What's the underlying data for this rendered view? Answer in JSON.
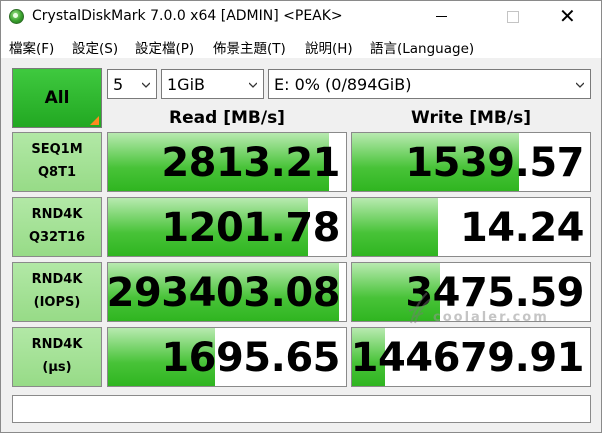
{
  "window": {
    "title": "CrystalDiskMark 7.0.0 x64 [ADMIN] <PEAK>",
    "close_glyph": "✕"
  },
  "menu": [
    {
      "label": "檔案(F)"
    },
    {
      "label": "設定(S)"
    },
    {
      "label": "設定檔(P)"
    },
    {
      "label": "佈景主題(T)"
    },
    {
      "label": "說明(H)"
    },
    {
      "label": "語言(Language)"
    }
  ],
  "controls": {
    "all_label": "All",
    "count": "5",
    "size": "1GiB",
    "drive": "E: 0% (0/894GiB)"
  },
  "columns": {
    "read": "Read [MB/s]",
    "write": "Write [MB/s]"
  },
  "rows": [
    {
      "line1": "SEQ1M",
      "line2": "Q8T1",
      "read": "2813.21",
      "write": "1539.57",
      "read_bar": 0.93,
      "write_bar": 0.7
    },
    {
      "line1": "RND4K",
      "line2": "Q32T16",
      "read": "1201.78",
      "write": "14.24",
      "read_bar": 0.84,
      "write_bar": 0.36
    },
    {
      "line1": "RND4K",
      "line2": "(IOPS)",
      "read": "293403.08",
      "write": "3475.59",
      "read_bar": 0.97,
      "write_bar": 0.37
    },
    {
      "line1": "RND4K",
      "line2": "(μs)",
      "read": "1695.65",
      "write": "144679.91",
      "read_bar": 0.45,
      "write_bar": 0.14
    }
  ],
  "status": "",
  "watermark": {
    "text": "coolaler.com"
  },
  "colors": {
    "accent_green": "#2fb520",
    "label_green": "#a6e399",
    "corner_orange": "#ff8a1e"
  }
}
